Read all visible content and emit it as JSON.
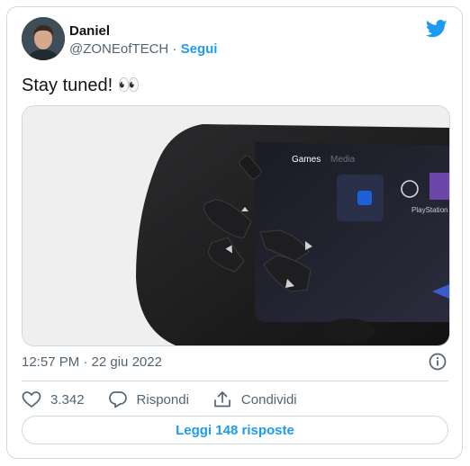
{
  "author": {
    "name": "Daniel",
    "handle": "@ZONEofTECH",
    "separator": "·",
    "follow_label": "Segui"
  },
  "tweet": {
    "text": "Stay tuned! 👀",
    "timestamp": "12:57 PM · 22 giu 2022"
  },
  "media": {
    "screen_tab_active": "Games",
    "screen_tab_inactive": "Media",
    "screen_tile_label": "PlayStation"
  },
  "actions": {
    "like_count": "3.342",
    "reply_label": "Rispondi",
    "share_label": "Condividi"
  },
  "replies_button": "Leggi 148 risposte",
  "colors": {
    "accent": "#1d9bf0",
    "text": "#0f1419",
    "secondary": "#536471",
    "border": "#cfd9de"
  },
  "icons": [
    "twitter-bird-icon",
    "info-icon",
    "heart-icon",
    "reply-icon",
    "share-icon"
  ]
}
